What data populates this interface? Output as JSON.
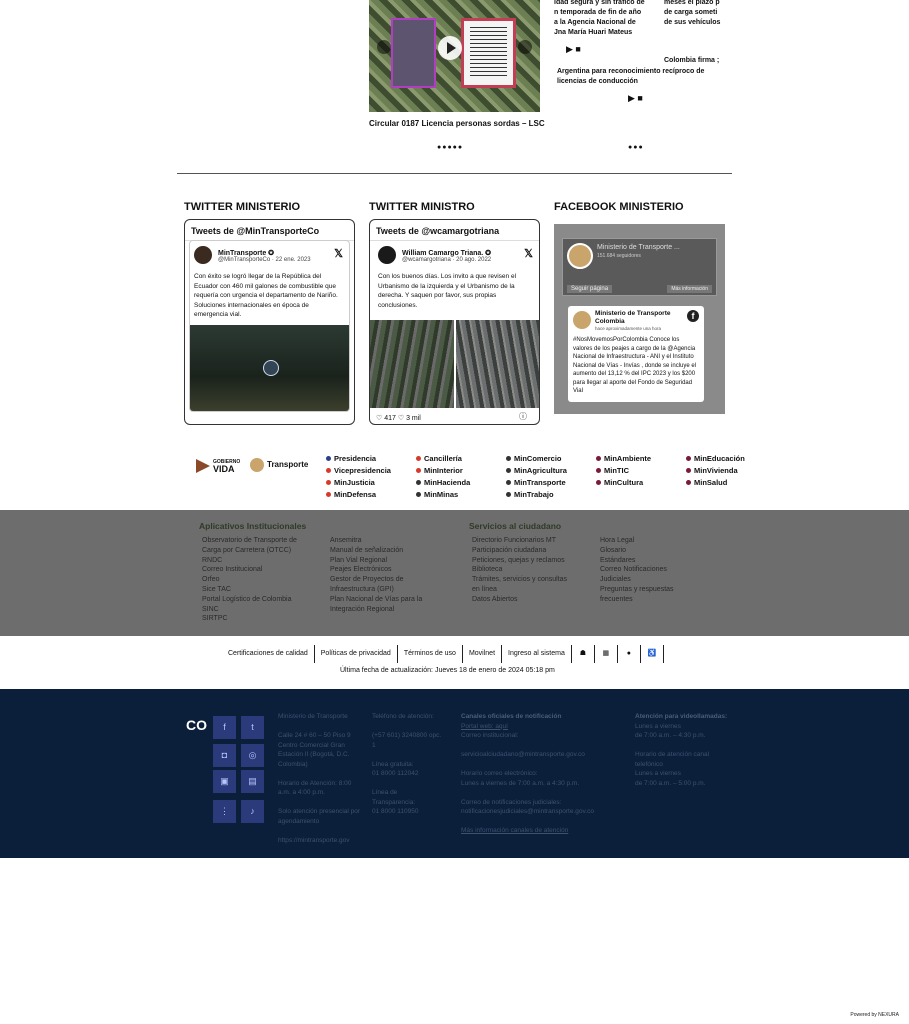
{
  "top": {
    "video_caption": "Circular 0187 Licencia personas sordas – LSC",
    "news_left": [
      "idad segura y sin tráfico de",
      "n temporada de fin de año",
      "a la Agencia Nacional de",
      "Jna María Huari Mateus"
    ],
    "news_right_top": [
      "meses el plazo p",
      "de carga someti",
      "de sus vehículos"
    ],
    "news_right_mid": [
      "Colombia firma ;"
    ],
    "news_center": [
      "Argentina para reconocimiento recíproco de",
      "licencias de conducción"
    ],
    "media_controls": "▶ ■",
    "dots_left": "●●●●●",
    "dots_right": "●●●"
  },
  "social": {
    "twitter_ministerio": {
      "title": "TWITTER MINISTERIO",
      "header": "Tweets de @MinTransporteCo",
      "name": "MinTransporte ✪",
      "handle": "@MinTransporteCo · 22 ene. 2023",
      "text": "Con éxito se logró llegar de la República del Ecuador con 460 mil galones de combustible que requería con urgencia el departamento de Nariño. Soluciones internacionales en época de emergencia vial."
    },
    "twitter_ministro": {
      "title": "TWITTER MINISTRO",
      "header": "Tweets de @wcamargotriana",
      "name": "William Camargo Triana. ✪",
      "handle": "@wcamargotriana · 20 ago. 2022",
      "text": "Con los buenos días. Los invito a que revisen el Urbanismo de la izquierda y el Urbanismo de la derecha. Y saquen por favor, sus propias conclusiones.",
      "stats": "♡ 417 ♡ 3 mil"
    },
    "facebook": {
      "title": "FACEBOOK MINISTERIO",
      "page_name": "Ministerio de Transporte ...",
      "page_followers": "151.684 seguidores",
      "follow": "Seguir página",
      "more": "Más información",
      "post_name": "Ministerio de Transporte Colombia",
      "post_when": "hace aproximadamente una hora",
      "post_text": "#NosMovemosPorColombia Conoce los valores de los peajes a cargo de la @Agencia Nacional de Infraestructura - ANI y el Instituto Nacional de Vías - Invías , donde se incluye el aumento del 13,12 % del IPC 2023 y los $200 para llegar al aporte del Fondo de Seguridad Vial"
    }
  },
  "gov": {
    "logo1": [
      "GOBIERNO",
      "VIDA"
    ],
    "logo2": "Transporte",
    "links": [
      {
        "label": "Presidencia",
        "color": "#2b3f8f"
      },
      {
        "label": "Cancillería",
        "color": "#d83a2a"
      },
      {
        "label": "MinComercio",
        "color": "#333333"
      },
      {
        "label": "MinAmbiente",
        "color": "#7a1a3a"
      },
      {
        "label": "MinEducación",
        "color": "#7a1a3a"
      },
      {
        "label": "Vicepresidencia",
        "color": "#d83a2a"
      },
      {
        "label": "MinInterior",
        "color": "#d83a2a"
      },
      {
        "label": "MinAgricultura",
        "color": "#333333"
      },
      {
        "label": "MinTIC",
        "color": "#7a1a3a"
      },
      {
        "label": "MinVivienda",
        "color": "#7a1a3a"
      },
      {
        "label": "MinJusticia",
        "color": "#d83a2a"
      },
      {
        "label": "MinHacienda",
        "color": "#333333"
      },
      {
        "label": "MinTransporte",
        "color": "#333333"
      },
      {
        "label": "MinCultura",
        "color": "#7a1a3a"
      },
      {
        "label": "MinSalud",
        "color": "#7a1a3a"
      },
      {
        "label": "MinDefensa",
        "color": "#d83a2a"
      },
      {
        "label": "MinMinas",
        "color": "#333333"
      },
      {
        "label": "MinTrabajo",
        "color": "#333333"
      }
    ]
  },
  "apps": {
    "heading_left": "Aplicativos Institucionales",
    "heading_right": "Servicios al ciudadano",
    "col1": [
      "Observatorio de Transporte de",
      "Carga por Carretera (OTCC)",
      "RNDC",
      "Correo Institucional",
      "Orfeo",
      "Sice TAC",
      "Portal Logístico de Colombia",
      "SINC",
      "SIRTPC"
    ],
    "col2": [
      "Ansemitra",
      "Manual de señalización",
      "Plan Vial Regional",
      "Peajes Electrónicos",
      "Gestor de Proyectos de",
      "Infraestructura (GPI)",
      "Plan Nacional de Vías para la",
      "Integración Regional"
    ],
    "col3": [
      "Directorio Funcionarios MT",
      "Participación ciudadana",
      "Peticiones, quejas y reclamos",
      "Biblioteca",
      "Trámites, servicios y consultas",
      "en línea",
      "Datos Abiertos"
    ],
    "col4": [
      "Hora Legal",
      "Glosario",
      "Estándares",
      "Correo Notificaciones",
      "Judiciales",
      "Preguntas y respuestas",
      "frecuentes"
    ]
  },
  "legal": {
    "links": [
      "Certificaciones de calidad",
      "Políticas de privacidad",
      "Términos de uso",
      "Movilnet",
      "Ingreso al sistema"
    ],
    "icons": [
      "sitemap-icon",
      "envelope-icon",
      "globe-icon",
      "accessibility-icon"
    ],
    "icon_glyphs": [
      "☗",
      "▦",
      "●",
      "♿"
    ],
    "updated": "Última fecha de actualización: Jueves 18 de enero de 2024 05:18 pm"
  },
  "footer": {
    "logo": "CO",
    "social_glyphs": [
      "f",
      "t",
      "◘",
      "◎",
      "▣",
      "▤",
      "⋮",
      "♪"
    ],
    "col_a": [
      "Ministerio de Transporte",
      "",
      "Calle 24 # 60 – 50 Piso 9",
      "Centro Comercial Gran",
      "Estación II (Bogotá, D.C.",
      "Colombia)",
      "",
      "Horario de Atención: 8:00",
      "a.m. a 4:00 p.m.",
      "",
      "Solo atención presencial por",
      "agendamiento",
      "",
      "https://mintransporte.gov"
    ],
    "col_b": [
      "Teléfono de atención:",
      "",
      "(+57 601) 3240800 opc.",
      "1",
      "",
      "Línea gratuita:",
      "01 8000 112042",
      "",
      "Línea de",
      "Transparencia:",
      "01 8000 110950"
    ],
    "col_c_head": "Canales oficiales de notificación",
    "col_c": [
      "Portal web: aquí",
      "Correo institucional:",
      "",
      "servicioalciudadano@mintransporte.gov.co",
      "",
      "Horario correo electrónico:",
      "Lunes a viernes de 7:00 a.m. a 4:30 p.m.",
      "",
      "Correo de notificaciones judiciales:",
      "notificacionesjudiciales@mintransporte.gov.co",
      "",
      "Más información canales de atención"
    ],
    "col_d_head": "Atención para videollamadas:",
    "col_d": [
      "Lunes a viernes",
      "de 7:00 a.m. – 4:30 p.m.",
      "",
      "Horario de atención canal",
      "telefónico",
      "Lunes a viernes",
      "de 7:00 a.m. – 5:00 p.m."
    ]
  },
  "powered": "Powered by NEXURA"
}
